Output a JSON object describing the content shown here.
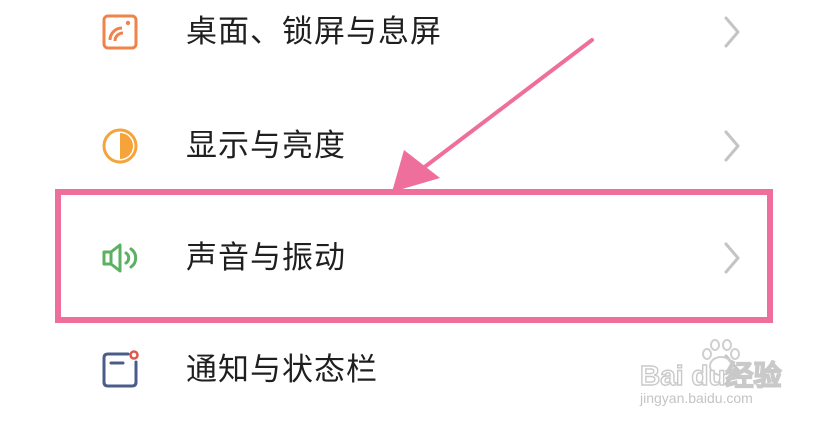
{
  "settings_list": {
    "items": [
      {
        "label": "桌面、锁屏与息屏",
        "icon": "wallpaper-icon",
        "icon_color": "#f0834a"
      },
      {
        "label": "显示与亮度",
        "icon": "brightness-icon",
        "icon_color": "#f4a43a"
      },
      {
        "label": "声音与振动",
        "icon": "speaker-icon",
        "icon_color": "#5ab15f"
      },
      {
        "label": "通知与状态栏",
        "icon": "notification-icon",
        "icon_color": "#4a5d8a"
      }
    ],
    "chevron_color": "#c4c4c4"
  },
  "annotation": {
    "highlight_color": "#ef6f9c",
    "highlighted_item": "声音与振动"
  },
  "watermark": {
    "brand": "Bai du经验",
    "url": "jingyan.baidu.com"
  }
}
